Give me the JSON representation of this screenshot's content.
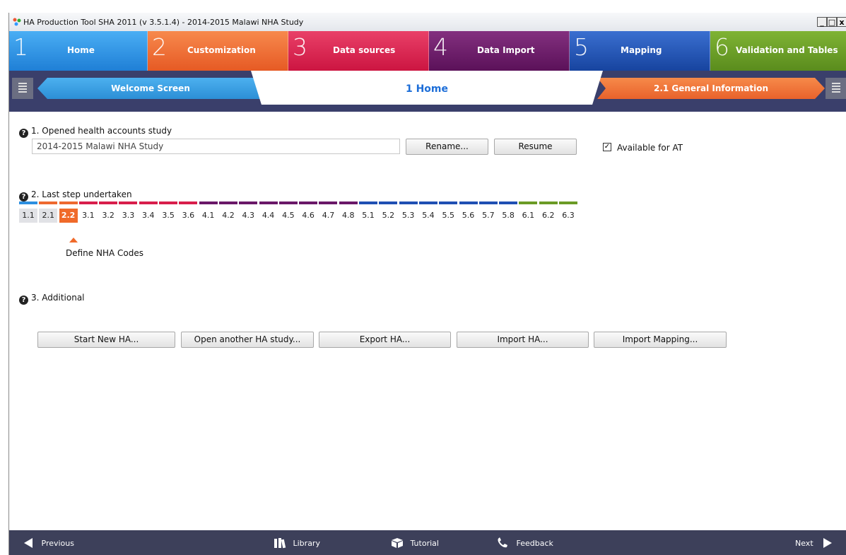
{
  "window": {
    "title": "HA Production Tool SHA 2011 (v 3.5.1.4) - 2014-2015 Malawi NHA Study",
    "min": "_",
    "max": "□",
    "close": "x"
  },
  "steps": [
    {
      "num": "1",
      "label": "Home",
      "color": "#2d8fe0"
    },
    {
      "num": "2",
      "label": "Customization",
      "color": "#ee6930"
    },
    {
      "num": "3",
      "label": "Data sources",
      "color": "#d81e4b"
    },
    {
      "num": "4",
      "label": "Data Import",
      "color": "#6a1868"
    },
    {
      "num": "5",
      "label": "Mapping",
      "color": "#1f4fb3"
    },
    {
      "num": "6",
      "label": "Validation and Tables",
      "color": "#6b9b25"
    }
  ],
  "breadcrumb": {
    "prev": "Welcome Screen",
    "current": "1 Home",
    "next": "2.1 General Information"
  },
  "section1": {
    "title": "1. Opened health accounts study",
    "study_value": "2014-2015 Malawi NHA Study",
    "rename": "Rename...",
    "resume": "Resume",
    "available_label": "Available for AT",
    "available_checked": true
  },
  "section2": {
    "title": "2. Last step undertaken",
    "steps": [
      "1.1",
      "2.1",
      "2.2",
      "3.1",
      "3.2",
      "3.3",
      "3.4",
      "3.5",
      "3.6",
      "4.1",
      "4.2",
      "4.3",
      "4.4",
      "4.5",
      "4.6",
      "4.7",
      "4.8",
      "5.1",
      "5.2",
      "5.3",
      "5.4",
      "5.5",
      "5.6",
      "5.7",
      "5.8",
      "6.1",
      "6.2",
      "6.3"
    ],
    "current": "2.2",
    "current_label": "Define NHA Codes"
  },
  "section3": {
    "title": "3. Additional",
    "buttons": [
      "Start New HA...",
      "Open another HA study...",
      "Export HA...",
      "Import HA...",
      "Import Mapping..."
    ]
  },
  "footer": {
    "previous": "Previous",
    "library": "Library",
    "tutorial": "Tutorial",
    "feedback": "Feedback",
    "next": "Next"
  }
}
